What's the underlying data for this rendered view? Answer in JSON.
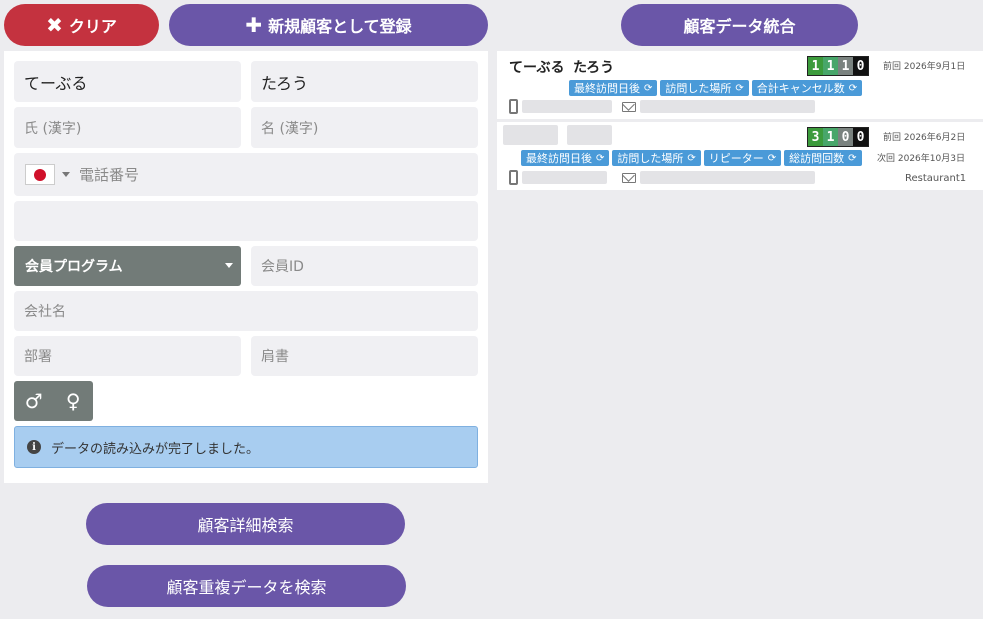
{
  "toolbar": {
    "clear_icon": "✖",
    "clear_label": "クリア",
    "register_icon": "✚",
    "register_label": "新規顧客として登録",
    "merge_label": "顧客データ統合"
  },
  "form": {
    "last_name_kana": "てーぶる",
    "first_name_kana": "たろう",
    "last_name_kanji_placeholder": "氏 (漢字)",
    "first_name_kanji_placeholder": "名 (漢字)",
    "phone_placeholder": "電話番号",
    "membership_program_label": "会員プログラム",
    "member_id_placeholder": "会員ID",
    "company_placeholder": "会社名",
    "department_placeholder": "部署",
    "title_placeholder": "肩書",
    "male_symbol": "♂",
    "female_symbol": "♀"
  },
  "alert": {
    "info_icon": "i",
    "message": "データの読み込みが完了しました。"
  },
  "actions": {
    "detail_search": "顧客詳細検索",
    "duplicate_search": "顧客重複データを検索"
  },
  "results": [
    {
      "last_name": "てーぶる",
      "first_name": "たろう",
      "counters": [
        "1",
        "1",
        "1",
        "0"
      ],
      "tags": [
        "最終訪問日後",
        "訪問した場所",
        "合計キャンセル数"
      ],
      "previous": "前回 2026年9月1日",
      "next": "",
      "restaurant": ""
    },
    {
      "last_name": "",
      "first_name": "",
      "counters": [
        "3",
        "1",
        "0",
        "0"
      ],
      "tags": [
        "最終訪問日後",
        "訪問した場所",
        "リピーター",
        "総訪問回数"
      ],
      "previous": "前回 2026年6月2日",
      "next": "次回 2026年10月3日",
      "restaurant": "Restaurant1"
    }
  ],
  "colors": {
    "purple": "#6a56a8",
    "red": "#c4323f",
    "tag_blue": "#4a9ad8",
    "alert_bg": "#a8cdf0"
  }
}
